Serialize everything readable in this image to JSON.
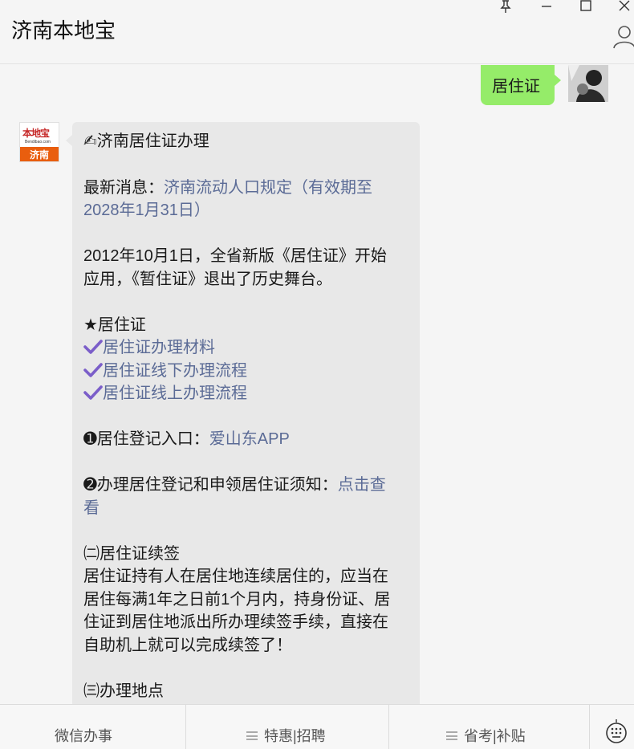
{
  "header": {
    "title": "济南本地宝"
  },
  "window_controls": [
    "pin-icon",
    "minimize-icon",
    "maximize-icon",
    "close-icon"
  ],
  "chat": {
    "user_message": "居住证",
    "bot_avatar": {
      "logo": "本地宝",
      "domain": "Bendibao.com",
      "city": "济南"
    },
    "reply": {
      "title_emoji": "✍",
      "title": "济南居住证办理",
      "news_prefix": "最新消息：",
      "news_link_line1": "济南流动人口规定（有效期至",
      "news_link_line2": "2028年1月31日）",
      "intro_line1": "2012年10月1日，全省新版《居住证》开始",
      "intro_line2": "应用，《暂住证》退出了历史舞台。",
      "section1": "★居住证",
      "check_links": [
        "居住证办理材料",
        "居住证线下办理流程",
        "居住证线上办理流程"
      ],
      "item1_prefix": "➊居住登记入口：",
      "item1_link": "爱山东APP",
      "item2_prefix": "➋办理居住登记和申领居住证须知：",
      "item2_link_part1": "点击查",
      "item2_link_part2": "看",
      "renew_heading": "㈡居住证续签",
      "renew_lines": [
        "居住证持有人在居住地连续居住的，应当在",
        "居住每满1年之日前1个月内，持身份证、居",
        "住证到居住地派出所办理续签手续，直接在",
        "自助机上就可以完成续签了！"
      ],
      "place_heading": "㈢办理地点"
    }
  },
  "bottom_menu": {
    "item1": "微信办事",
    "item2": "特惠|招聘",
    "item3": "省考|补贴"
  },
  "colors": {
    "user_bubble": "#95ec69",
    "link": "#5b6b96",
    "check": "#7b5ec9",
    "logo_band": "#e95e0e"
  }
}
